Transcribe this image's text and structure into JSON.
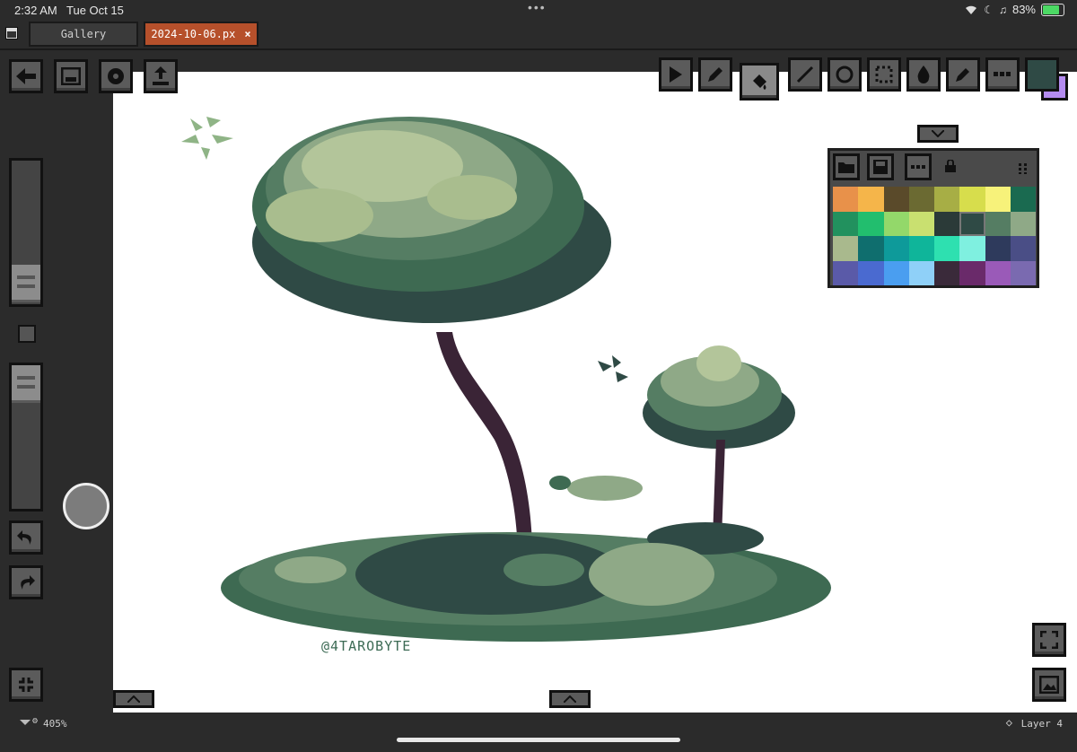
{
  "status_bar": {
    "time": "2:32 AM",
    "date": "Tue Oct 15",
    "battery": "83%"
  },
  "tabs": [
    {
      "label": "Gallery"
    },
    {
      "label": "2024-10-06.px",
      "close": "×"
    }
  ],
  "colors": {
    "accent": "#b6502b",
    "current_color": "#2f4a45",
    "secondary_color": "#b48cf0"
  },
  "palette": {
    "swatches": [
      "#e8914a",
      "#f5b54a",
      "#5a4a2a",
      "#6b6a32",
      "#a7ae45",
      "#d7dd4c",
      "#f7f27a",
      "#1a6a50",
      "#22915e",
      "#22be6e",
      "#93d86a",
      "#c9e070",
      "#2b3a38",
      "#2f4a45",
      "#557d63",
      "#8fa987",
      "#a9b98d",
      "#0f6e6e",
      "#0e9a9a",
      "#0fb59a",
      "#2ee0b0",
      "#7ff0e0",
      "#2e3a5c",
      "#4a4e86",
      "#5a5aa8",
      "#4a6ad0",
      "#4a9ef0",
      "#8fd0f8",
      "#3a2a3a",
      "#6a2a6a",
      "#9a5ab8",
      "#7a6ab0"
    ],
    "selected_index": 13
  },
  "footer": {
    "zoom": "405%",
    "layer": "Layer 4"
  },
  "canvas": {
    "watermark": "@4TAROBYTE"
  },
  "icons": {
    "back": "arrow-left-icon",
    "image": "image-icon",
    "settings": "gear-icon",
    "share": "share-icon",
    "play": "play-icon",
    "pencil": "pencil-icon",
    "fill": "bucket-icon",
    "line": "line-icon",
    "circle": "circle-icon",
    "select": "select-icon",
    "blur": "drop-icon",
    "eyedropper": "eyedropper-icon",
    "more": "more-icon",
    "undo": "undo-icon",
    "redo": "redo-icon"
  }
}
